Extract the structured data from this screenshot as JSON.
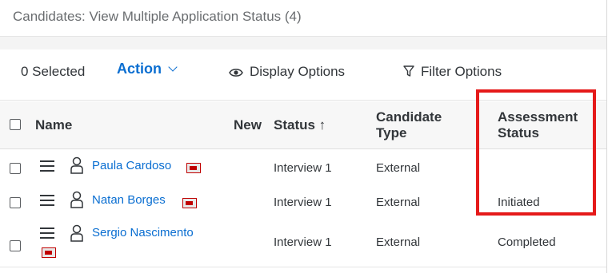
{
  "title": "Candidates: View Multiple Application Status (4)",
  "toolbar": {
    "selected": "0 Selected",
    "action": "Action",
    "display_options": "Display Options",
    "filter_options": "Filter Options"
  },
  "columns": {
    "name": "Name",
    "new": "New",
    "status": "Status ↑",
    "candidate_type_1": "Candidate",
    "candidate_type_2": "Type",
    "assessment_1": "Assessment",
    "assessment_2": "Status"
  },
  "rows": [
    {
      "name": "Paula Cardoso",
      "status": "Interview 1",
      "type": "External",
      "assessment": ""
    },
    {
      "name": "Natan Borges",
      "status": "Interview 1",
      "type": "External",
      "assessment": "Initiated"
    },
    {
      "name": "Sergio Nascimento",
      "status": "Interview 1",
      "type": "External",
      "assessment": "Completed"
    }
  ],
  "colors": {
    "link": "#0a6ed1",
    "highlight": "#e51a1a",
    "resume_icon": "#c00000"
  },
  "icons": [
    "eye-icon",
    "filter-icon",
    "chevron-down-icon",
    "hamburger-icon",
    "person-icon",
    "resume-icon"
  ]
}
